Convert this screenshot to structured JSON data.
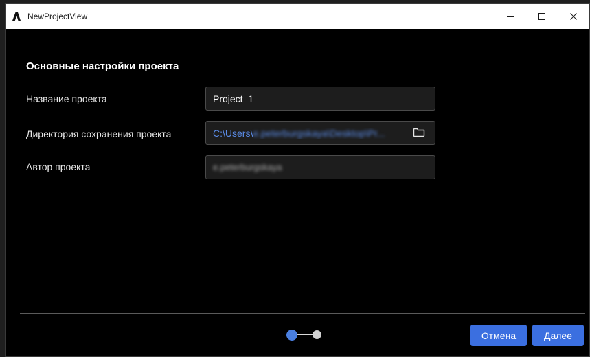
{
  "window": {
    "title": "NewProjectView",
    "controls": {
      "minimize": "—",
      "maximize": "☐",
      "close": "✕"
    }
  },
  "form": {
    "heading": "Основные настройки проекта",
    "project_name": {
      "label": "Название проекта",
      "value": "Project_1"
    },
    "directory": {
      "label": "Директория сохранения проекта",
      "value_prefix": "C:\\Users\\",
      "value_rest": "e.peterburgskaya\\Desktop\\Pr...",
      "icon": "folder-icon"
    },
    "author": {
      "label": "Автор проекта",
      "value": "e.peterburgskaya"
    }
  },
  "stepper": {
    "current_step": 1,
    "total_steps": 2
  },
  "footer": {
    "cancel_label": "Отмена",
    "next_label": "Далее"
  },
  "colors": {
    "accent": "#3b6fe0",
    "background": "#000000",
    "path_link": "#5b8ce8"
  }
}
